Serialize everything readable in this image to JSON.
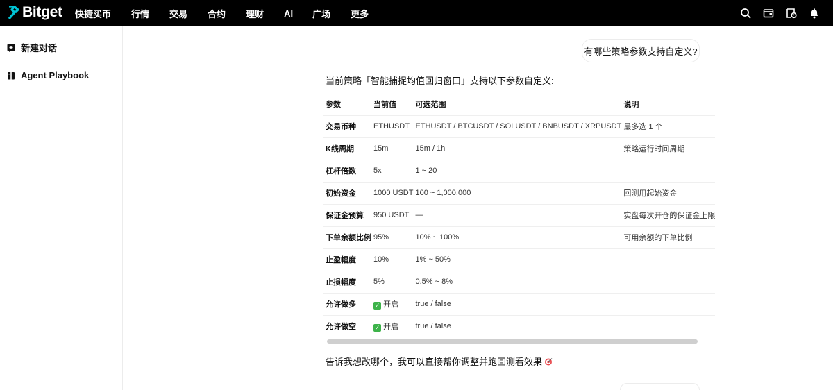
{
  "brand": {
    "name": "Bitget",
    "accent": "#00c3d4"
  },
  "nav": {
    "items": [
      {
        "label": "快捷买币"
      },
      {
        "label": "行情"
      },
      {
        "label": "交易"
      },
      {
        "label": "合约"
      },
      {
        "label": "理财"
      },
      {
        "label": "AI"
      },
      {
        "label": "广场"
      },
      {
        "label": "更多"
      }
    ],
    "icons": [
      "search-icon",
      "wallet-icon",
      "assets-icon",
      "bell-icon"
    ]
  },
  "sidebar": {
    "new_chat": {
      "label": "新建对话",
      "icon": "plus-square-icon"
    },
    "playbook": {
      "label": "Agent Playbook",
      "icon": "book-icon"
    }
  },
  "chat": {
    "user_question": "有哪些策略参数支持自定义?",
    "intro": "当前策略「智能捕捉均值回归窗口」支持以下参数自定义:",
    "table": {
      "headers": [
        "参数",
        "当前值",
        "可选范围",
        "说明"
      ],
      "rows": [
        {
          "param": "交易币种",
          "value": "ETHUSDT",
          "range": "ETHUSDT / BTCUSDT / SOLUSDT / BNBUSDT / XRPUSDT",
          "note": "最多选 1 个"
        },
        {
          "param": "K线周期",
          "value": "15m",
          "range": "15m / 1h",
          "note": "策略运行时间周期"
        },
        {
          "param": "杠杆倍数",
          "value": "5x",
          "range": "1 ~ 20",
          "note": ""
        },
        {
          "param": "初始资金",
          "value": "1000 USDT",
          "range": "100 ~ 1,000,000",
          "note": "回测用起始资金"
        },
        {
          "param": "保证金预算",
          "value": "950 USDT",
          "range": "—",
          "note": "实盘每次开仓的保证金上限"
        },
        {
          "param": "下单余额比例",
          "value": "95%",
          "range": "10% ~ 100%",
          "note": "可用余额的下单比例"
        },
        {
          "param": "止盈幅度",
          "value": "10%",
          "range": "1% ~ 50%",
          "note": ""
        },
        {
          "param": "止损幅度",
          "value": "5%",
          "range": "0.5% ~ 8%",
          "note": ""
        },
        {
          "param": "允许做多",
          "value": "开启",
          "value_icon": "check-icon",
          "range": "true / false",
          "note": ""
        },
        {
          "param": "允许做空",
          "value": "开启",
          "value_icon": "check-icon",
          "range": "true / false",
          "note": ""
        }
      ]
    },
    "followup": "告诉我想改哪个，我可以直接帮你调整并跑回测看效果"
  }
}
